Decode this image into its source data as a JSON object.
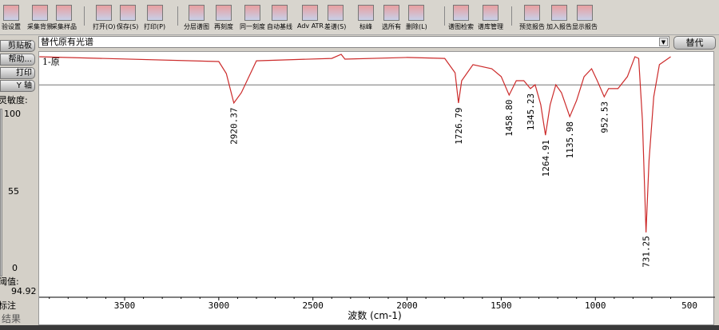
{
  "toolbar": {
    "items": [
      {
        "label": "验设置",
        "icon": "settings-icon"
      },
      {
        "label": "采集背景",
        "icon": "collect-background-icon"
      },
      {
        "label": "采集样品",
        "icon": "collect-sample-icon"
      },
      {
        "label": "打开(O)",
        "icon": "open-icon"
      },
      {
        "label": "保存(S)",
        "icon": "save-icon"
      },
      {
        "label": "打印(P)",
        "icon": "print-icon"
      },
      {
        "label": "分层谱图",
        "icon": "layered-spectra-icon"
      },
      {
        "label": "再刻度",
        "icon": "rescale-icon"
      },
      {
        "label": "同一刻度",
        "icon": "same-scale-icon"
      },
      {
        "label": "自动基线",
        "icon": "auto-baseline-icon"
      },
      {
        "label": "Adv ATR",
        "icon": "atr-icon"
      },
      {
        "label": "差谱(S)",
        "icon": "subtract-icon"
      },
      {
        "label": "标峰",
        "icon": "peak-label-icon"
      },
      {
        "label": "选所有",
        "icon": "select-all-icon"
      },
      {
        "label": "删除(L)",
        "icon": "delete-icon"
      },
      {
        "label": "谱图检索",
        "icon": "search-icon"
      },
      {
        "label": "谱库管理",
        "icon": "library-icon"
      },
      {
        "label": "预览报告",
        "icon": "preview-report-icon"
      },
      {
        "label": "加入报告",
        "icon": "add-report-icon"
      },
      {
        "label": "显示报告",
        "icon": "show-report-icon"
      }
    ]
  },
  "combo": {
    "value": "替代原有光谱"
  },
  "replace_button": "替代",
  "left": {
    "clipboard": "剪贴板",
    "help": "帮助...",
    "print": "打印",
    "yaxis": "Y 轴",
    "sensitivity": "灵敏度:",
    "s100": "100",
    "s55": "55",
    "s0": "0",
    "threshold_label": "阈值:",
    "threshold": "94.92",
    "annotate": "标注",
    "result": "结果"
  },
  "chart_data": {
    "type": "line",
    "title": "1-原",
    "xlabel": "波数 (cm-1)",
    "xlim": [
      3953,
      590
    ],
    "ylim": [
      0,
      100
    ],
    "xticks": [
      3500,
      3000,
      2500,
      2000,
      1500,
      1000,
      500
    ],
    "threshold": 94.92,
    "color": "#cc2b2b",
    "points": [
      [
        3953,
        100
      ],
      [
        3000,
        98
      ],
      [
        2960,
        93
      ],
      [
        2920,
        80.7
      ],
      [
        2880,
        85
      ],
      [
        2850,
        90
      ],
      [
        2800,
        98.3
      ],
      [
        2400,
        99.3
      ],
      [
        2350,
        101
      ],
      [
        2330,
        99
      ],
      [
        2000,
        99.7
      ],
      [
        1800,
        99.3
      ],
      [
        1745,
        93.3
      ],
      [
        1727,
        80.7
      ],
      [
        1710,
        90
      ],
      [
        1650,
        96.7
      ],
      [
        1550,
        95
      ],
      [
        1500,
        91.7
      ],
      [
        1458,
        84
      ],
      [
        1420,
        90
      ],
      [
        1380,
        90
      ],
      [
        1345,
        86.7
      ],
      [
        1320,
        88.3
      ],
      [
        1290,
        80
      ],
      [
        1265,
        67.3
      ],
      [
        1240,
        80
      ],
      [
        1210,
        88.3
      ],
      [
        1180,
        85
      ],
      [
        1136,
        75
      ],
      [
        1100,
        81.7
      ],
      [
        1060,
        91.7
      ],
      [
        1020,
        95
      ],
      [
        990,
        90
      ],
      [
        953,
        83.3
      ],
      [
        930,
        86.7
      ],
      [
        880,
        86.7
      ],
      [
        830,
        91.7
      ],
      [
        790,
        100
      ],
      [
        770,
        99.3
      ],
      [
        750,
        73.3
      ],
      [
        731,
        26.7
      ],
      [
        715,
        56.7
      ],
      [
        690,
        83.3
      ],
      [
        660,
        96.7
      ],
      [
        600,
        100
      ]
    ],
    "peaks": [
      {
        "x": 2920.37,
        "label": "2920.37"
      },
      {
        "x": 1726.79,
        "label": "1726.79"
      },
      {
        "x": 1458.8,
        "label": "1458.80"
      },
      {
        "x": 1345.23,
        "label": "1345.23"
      },
      {
        "x": 1264.91,
        "label": "1264.91"
      },
      {
        "x": 1135.98,
        "label": "1135.98"
      },
      {
        "x": 952.53,
        "label": "952.53"
      },
      {
        "x": 731.25,
        "label": "731.25"
      }
    ]
  }
}
